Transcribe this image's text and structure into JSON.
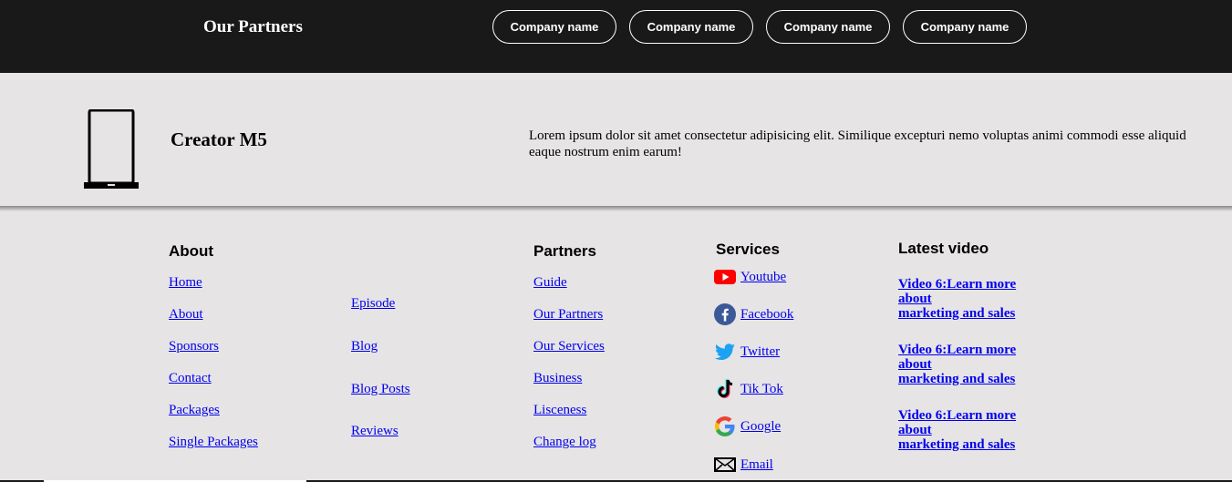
{
  "partners": {
    "title": "Our Partners",
    "companies": [
      "Company name",
      "Company name",
      "Company name",
      "Company name"
    ]
  },
  "product": {
    "name": "Creator M5",
    "description": "Lorem ipsum dolor sit amet consectetur adipisicing elit. Similique excepturi nemo voluptas animi commodi esse aliquid eaque nostrum enim earum!"
  },
  "footer": {
    "about": {
      "heading": "About",
      "links": [
        "Home",
        "About",
        "Sponsors",
        "Contact",
        "Packages",
        "Single Packages"
      ],
      "links2": [
        "Episode",
        "Blog",
        "Blog Posts",
        "Reviews"
      ]
    },
    "partners": {
      "heading": "Partners",
      "links": [
        "Guide",
        "Our Partners",
        "Our Services",
        "Business",
        "Lisceness",
        "Change log"
      ]
    },
    "services": {
      "heading": "Services",
      "links": [
        {
          "label": " Youtube",
          "icon": "youtube-icon"
        },
        {
          "label": " Facebook",
          "icon": "facebook-icon"
        },
        {
          "label": " Twitter",
          "icon": "twitter-icon"
        },
        {
          "label": " Tik Tok",
          "icon": "tiktok-icon"
        },
        {
          "label": " Google",
          "icon": "google-icon"
        },
        {
          "label": " Email",
          "icon": "email-icon"
        }
      ]
    },
    "latest_video": {
      "heading": "Latest video",
      "videos": [
        {
          "line1": "Video 6:Learn more about",
          "line2": "marketing and sales"
        },
        {
          "line1": "Video 6:Learn more about",
          "line2": "marketing and sales"
        },
        {
          "line1": "Video 6:Learn more about",
          "line2": "marketing and sales"
        }
      ]
    }
  },
  "colors": {
    "dark_bar": "#191919",
    "page_bg": "#e6e4e5",
    "link": "#0000ee",
    "youtube": "#ff0000",
    "facebook": "#3b5998",
    "twitter": "#1da1f2"
  }
}
